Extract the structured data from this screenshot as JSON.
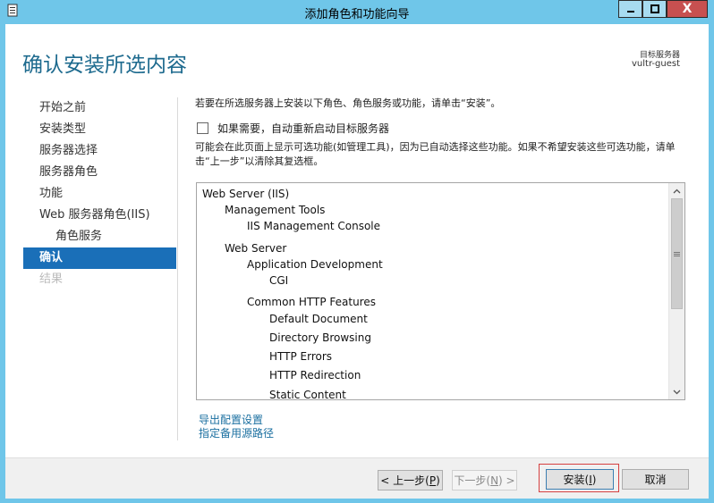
{
  "window": {
    "title": "添加角色和功能向导",
    "minimize_glyph": "_",
    "maximize_glyph": "□",
    "close_glyph": "X"
  },
  "header": {
    "title": "确认安装所选内容",
    "destination_label": "目标服务器",
    "destination_value": "vultr-guest"
  },
  "nav": {
    "items": [
      {
        "label": "开始之前"
      },
      {
        "label": "安装类型"
      },
      {
        "label": "服务器选择"
      },
      {
        "label": "服务器角色"
      },
      {
        "label": "功能"
      },
      {
        "label": "Web 服务器角色(IIS)"
      },
      {
        "label": "角色服务"
      },
      {
        "label": "确认"
      },
      {
        "label": "结果"
      }
    ]
  },
  "content": {
    "intro": "若要在所选服务器上安装以下角色、角色服务或功能，请单击“安装”。",
    "restart_checkbox_label": "如果需要，自动重新启动目标服务器",
    "restart_checked": false,
    "note": "可能会在此页面上显示可选功能(如管理工具)，因为已自动选择这些功能。如果不希望安装这些可选功能，请单击“上一步”以清除其复选框。"
  },
  "features": [
    {
      "label": "Web Server (IIS)",
      "level": 0
    },
    {
      "label": "Management Tools",
      "level": 1
    },
    {
      "label": "IIS Management Console",
      "level": 2
    },
    {
      "label": "Web Server",
      "level": 1
    },
    {
      "label": "Application Development",
      "level": 2
    },
    {
      "label": "CGI",
      "level": 3
    },
    {
      "label": "Common HTTP Features",
      "level": 2
    },
    {
      "label": "Default Document",
      "level": 3
    },
    {
      "label": "Directory Browsing",
      "level": 3
    },
    {
      "label": "HTTP Errors",
      "level": 3
    },
    {
      "label": "HTTP Redirection",
      "level": 3
    },
    {
      "label": "Static Content",
      "level": 3
    }
  ],
  "links": {
    "export": "导出配置设置",
    "alternate_source": "指定备用源路径"
  },
  "footer": {
    "prev_label": "< 上一步(",
    "prev_key": "P",
    "next_label": "下一步(",
    "next_key": "N",
    "next_suffix": ") >",
    "install_label": "安装(",
    "install_key": "I",
    "cancel_label": "取消"
  },
  "colors": {
    "accent": "#1a6fb8",
    "title": "#1d6a8e",
    "frame": "#6fc6e9",
    "highlight_border": "#d64040"
  }
}
